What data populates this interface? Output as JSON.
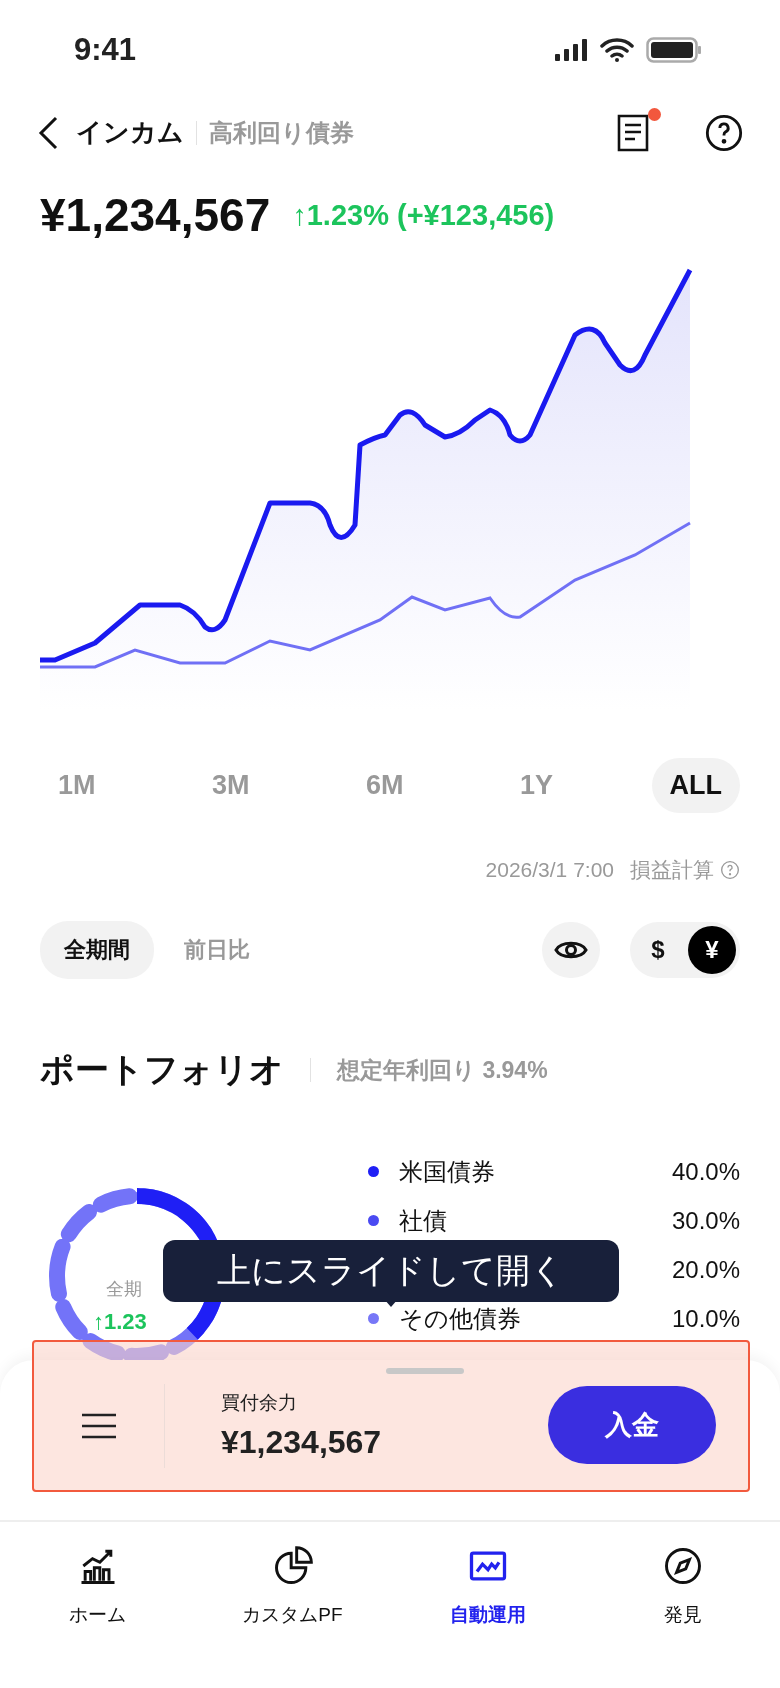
{
  "status_bar": {
    "time": "9:41"
  },
  "header": {
    "title": "インカム",
    "subtitle": "高利回り債券",
    "notice_badge": true
  },
  "summary": {
    "value": "¥1,234,567",
    "change": "↑1.23% (+¥123,456)"
  },
  "periods": [
    {
      "label": "1M",
      "selected": false
    },
    {
      "label": "3M",
      "selected": false
    },
    {
      "label": "6M",
      "selected": false
    },
    {
      "label": "1Y",
      "selected": false
    },
    {
      "label": "ALL",
      "selected": true
    }
  ],
  "updated": {
    "timestamp": "2026/3/1 7:00",
    "link": "損益計算"
  },
  "compare_tabs": [
    {
      "label": "全期間",
      "selected": true
    },
    {
      "label": "前日比",
      "selected": false
    }
  ],
  "currency": [
    {
      "label": "$",
      "selected": false
    },
    {
      "label": "¥",
      "selected": true
    }
  ],
  "portfolio": {
    "title": "ポートフォリオ",
    "yield": "想定年利回り 3.94%",
    "donut_label": "全期",
    "donut_change": "↑1.23",
    "legend": [
      {
        "name": "米国債券",
        "value": "40.0%",
        "color": "#1f1ff5"
      },
      {
        "name": "社債",
        "value": "30.0%",
        "color": "#4a4af2"
      },
      {
        "value": "20.0%"
      },
      {
        "name": "その他債券",
        "value": "10.0%",
        "color": "#7777f7"
      }
    ]
  },
  "tooltip": "上にスライドして開く",
  "sheet": {
    "highlighted": true,
    "label": "買付余力",
    "value": "¥1,234,567",
    "action": "入金"
  },
  "nav": [
    {
      "label": "ホーム",
      "selected": false
    },
    {
      "label": "カスタムPF",
      "selected": false
    },
    {
      "label": "自動運用",
      "selected": true
    },
    {
      "label": "発見",
      "selected": false
    }
  ]
}
